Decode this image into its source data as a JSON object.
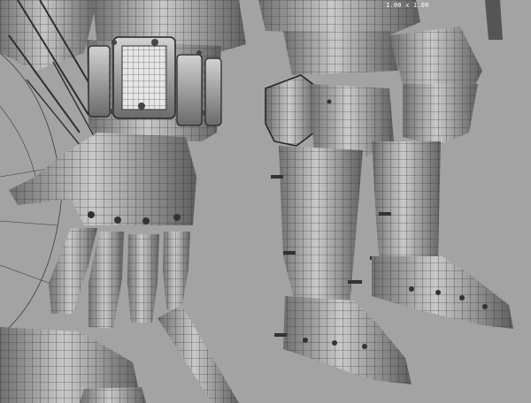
{
  "viewport": {
    "resolution_gate_label": "1.00 x 1.00",
    "background_color": "#a3a3a3",
    "mesh_fill_color": "#8d8d8d",
    "mesh_highlight_color": "#e6e6e6",
    "wire_color": "#2b2b2b"
  },
  "objects": [
    "gauntlet-mesh",
    "finger-mesh",
    "left-greave-mesh",
    "right-greave-mesh",
    "left-sabaton-mesh",
    "right-sabaton-mesh",
    "sword-blade-mesh"
  ]
}
